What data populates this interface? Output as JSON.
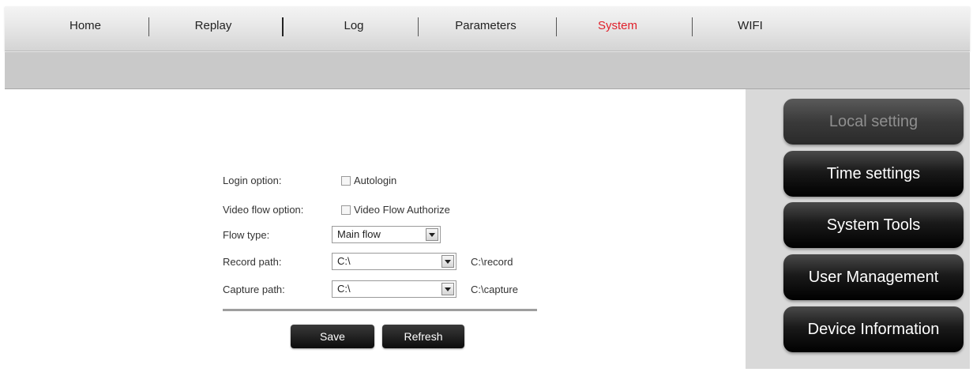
{
  "nav": {
    "items": [
      {
        "label": "Home"
      },
      {
        "label": "Replay"
      },
      {
        "label": "Log"
      },
      {
        "label": "Parameters"
      },
      {
        "label": "System",
        "active": true
      },
      {
        "label": "WIFI"
      }
    ]
  },
  "form": {
    "login_option": {
      "label": "Login option:",
      "checkbox_label": "Autologin",
      "checked": false
    },
    "video_flow_option": {
      "label": "Video flow option:",
      "checkbox_label": "Video Flow Authorize",
      "checked": false
    },
    "flow_type": {
      "label": "Flow type:",
      "value": "Main flow"
    },
    "record_path": {
      "label": "Record path:",
      "value": "C:\\",
      "resolved": "C:\\record"
    },
    "capture_path": {
      "label": "Capture path:",
      "value": "C:\\",
      "resolved": "C:\\capture"
    },
    "save_label": "Save",
    "refresh_label": "Refresh"
  },
  "sidebar": {
    "items": [
      {
        "label": "Local setting",
        "current": true
      },
      {
        "label": "Time settings"
      },
      {
        "label": "System Tools"
      },
      {
        "label": "User Management"
      },
      {
        "label": "Device Information"
      }
    ]
  },
  "colors": {
    "active_nav": "#e0202a",
    "button_dark": "#0c0c0c",
    "sidebar_bg": "#d9d9d9"
  }
}
